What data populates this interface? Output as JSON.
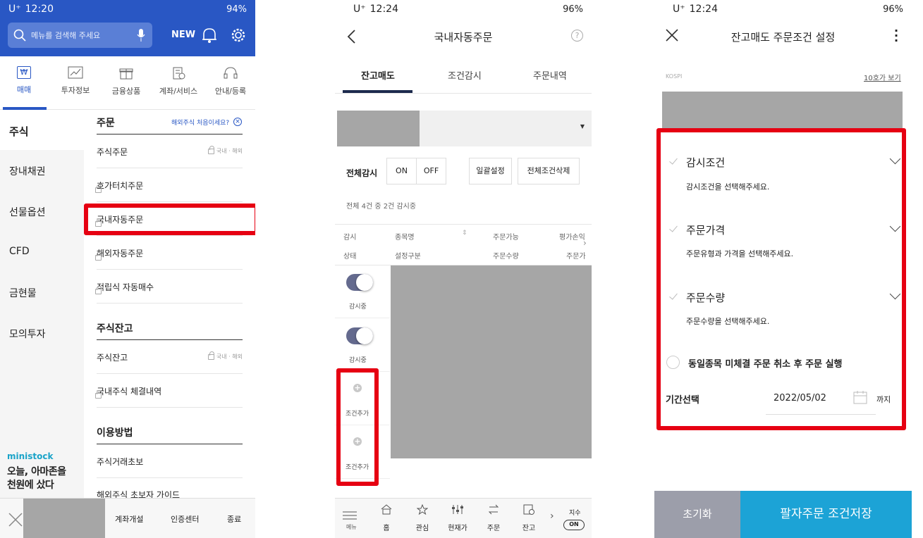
{
  "panel1": {
    "status": {
      "carrier": "U⁺",
      "time": "12:20",
      "battery": "94%"
    },
    "search": {
      "placeholder": "메뉴를 검색해 주세요"
    },
    "new_label": "NEW",
    "tabs": [
      {
        "label": "매매",
        "icon": "won-icon"
      },
      {
        "label": "투자정보",
        "icon": "chart-icon"
      },
      {
        "label": "금융상품",
        "icon": "gift-icon"
      },
      {
        "label": "계좌/서비스",
        "icon": "building-icon"
      },
      {
        "label": "안내/등록",
        "icon": "headset-icon"
      }
    ],
    "categories": [
      "주식",
      "장내채권",
      "선물옵션",
      "CFD",
      "금현물",
      "모의투자"
    ],
    "sections": {
      "order": {
        "title": "주문",
        "hint": "해외주식 처음이세요?",
        "items": [
          "주식주문",
          "호가터치주문",
          "국내자동주문",
          "해외자동주문",
          "적립식 자동매수"
        ],
        "tag": "국내 · 해외"
      },
      "balance": {
        "title": "주식잔고",
        "items": [
          "주식잔고",
          "국내주식 체결내역"
        ],
        "tag": "국내 · 해외"
      },
      "usage": {
        "title": "이용방법",
        "items": [
          "주식거래초보",
          "해외주식 초보자 가이드"
        ]
      }
    },
    "promo": {
      "brand": "ministock",
      "line1": "오늘, 아마존을",
      "line2": "천원에 샀다"
    },
    "footer": [
      "계좌개설",
      "인증센터",
      "종료"
    ]
  },
  "panel2": {
    "status": {
      "carrier": "U⁺",
      "time": "12:24",
      "battery": "96%"
    },
    "title": "국내자동주문",
    "tabs": [
      "잔고매도",
      "조건감시",
      "주문내역"
    ],
    "monitor_all_label": "전체감시",
    "on_label": "ON",
    "off_label": "OFF",
    "batch_label": "일괄설정",
    "delete_all_label": "전체조건삭제",
    "summary": "전체 4건 중 2건 감시중",
    "table_headers": {
      "row1": [
        "감시",
        "종목명",
        "주문가능",
        "평가손익"
      ],
      "row2": [
        "상태",
        "설정구분",
        "주문수량",
        "주문가"
      ]
    },
    "rows": [
      {
        "status": "감시중"
      },
      {
        "status": "감시중"
      },
      {
        "status": "조건추가"
      },
      {
        "status": "조건추가"
      }
    ],
    "bottom_nav": [
      {
        "label": "메뉴",
        "icon": "menu-icon"
      },
      {
        "label": "홈",
        "icon": "home-icon"
      },
      {
        "label": "관심",
        "icon": "star-icon"
      },
      {
        "label": "현재가",
        "icon": "sliders-icon"
      },
      {
        "label": "주문",
        "icon": "swap-icon"
      },
      {
        "label": "잔고",
        "icon": "doc-icon"
      }
    ],
    "index_label": "지수",
    "index_state": "ON"
  },
  "panel3": {
    "status": {
      "carrier": "U⁺",
      "time": "12:24",
      "battery": "96%"
    },
    "title": "잔고매도 주문조건 설정",
    "market": "KOSPI",
    "quote_link": "10호가 보기",
    "conditions": [
      {
        "title": "감시조건",
        "desc": "감시조건을 선택해주세요."
      },
      {
        "title": "주문가격",
        "desc": "주문유형과 가격을 선택해주세요."
      },
      {
        "title": "주문수량",
        "desc": "주문수량을 선택해주세요."
      }
    ],
    "cancel_option": "동일종목 미체결 주문 취소 후 주문 실행",
    "period_label": "기간선택",
    "date": "2022/05/02",
    "until": "까지",
    "reset_label": "초기화",
    "save_label": "팔자주문 조건저장"
  }
}
